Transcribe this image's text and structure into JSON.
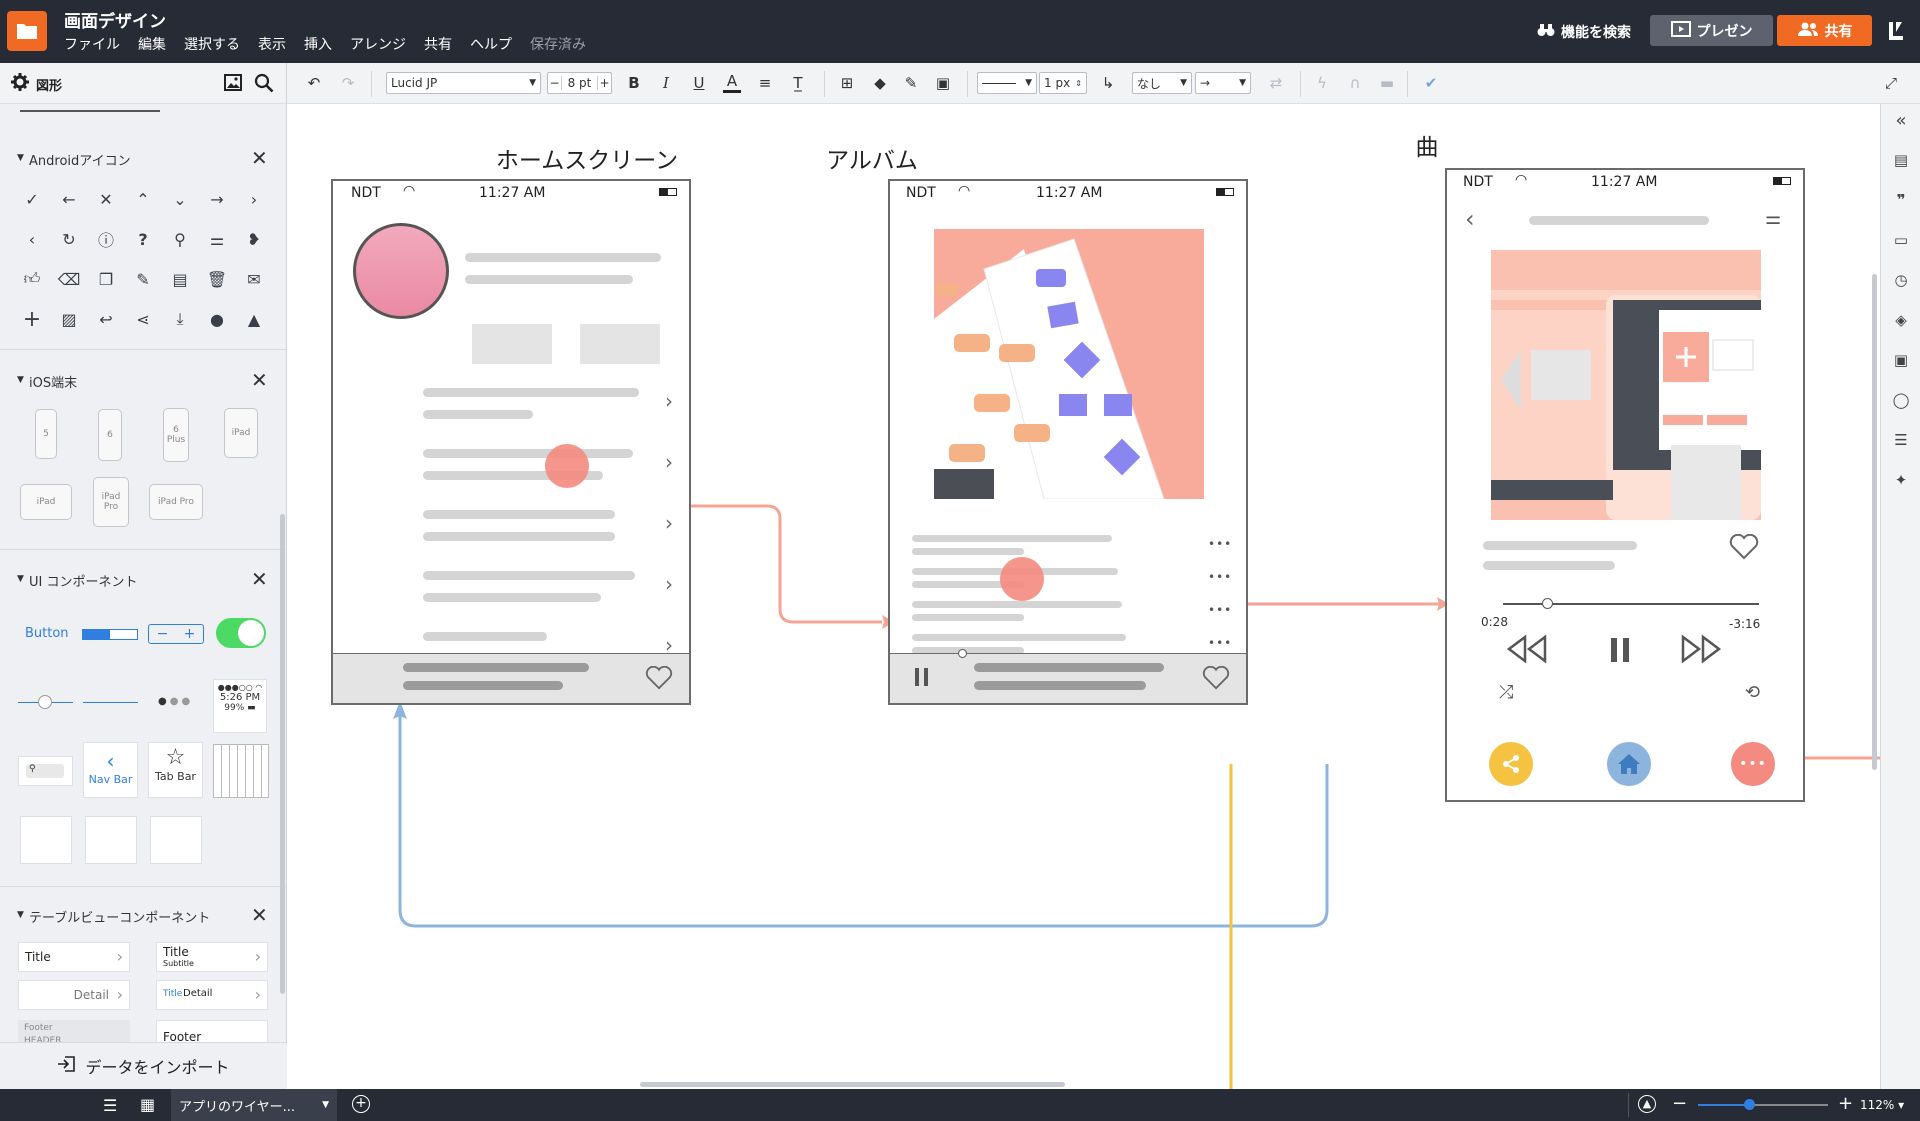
{
  "app": {
    "title": "画面デザイン",
    "menu": [
      "ファイル",
      "編集",
      "選択する",
      "表示",
      "挿入",
      "アレンジ",
      "共有",
      "ヘルプ"
    ],
    "save_status": "保存済み",
    "feature_search": "機能を検索",
    "present_label": "プレゼン",
    "share_label": "共有",
    "accent_color": "#f06a23"
  },
  "shapes_panel": {
    "title": "図形",
    "sections": {
      "android": "Androidアイコン",
      "ios": "iOS端末",
      "ui": "UI コンポーネント",
      "tableview": "テーブルビューコンポーネント"
    },
    "ios_devices": [
      "5",
      "6",
      "6 Plus",
      "iPad",
      "iPad",
      "iPad Pro",
      "iPad Pro"
    ],
    "ui_components": {
      "button": "Button",
      "status_time": "5:26 PM",
      "status_battery": "99%",
      "navbar": "Nav Bar",
      "tabbar": "Tab Bar"
    },
    "table_cells": {
      "title": "Title",
      "title2": "Title",
      "subtitle": "Subtitle",
      "detail": "Detail",
      "title3": "Title",
      "detail2": "Detail",
      "footer_small": "Footer",
      "header_small": "HEADER",
      "footer": "Footer"
    },
    "import_label": "データをインポート"
  },
  "toolbar": {
    "font": "Lucid JP",
    "font_size": "8 pt",
    "line_width": "1 px",
    "arrow_none": "なし"
  },
  "canvas": {
    "frames": [
      {
        "title": "ホームスクリーン",
        "carrier": "NDT",
        "time": "11:27 AM"
      },
      {
        "title": "アルバム",
        "carrier": "NDT",
        "time": "11:27 AM"
      },
      {
        "title": "曲",
        "carrier": "NDT",
        "time": "11:27 AM"
      }
    ],
    "song": {
      "elapsed": "0:28",
      "remaining": "-3:16",
      "progress_fraction": 0.17
    },
    "colors": {
      "flow_red": "#f5a595",
      "flow_blue": "#8db4dd",
      "share_yellow": "#f5c242",
      "home_blue": "#8db4dd",
      "more_red": "#f58a80",
      "avatar_pink": "#ee9ab0"
    }
  },
  "bottom": {
    "page_name": "アプリのワイヤー...",
    "zoom": "112%"
  },
  "icons": [
    "folder-icon",
    "binoculars-icon",
    "present-icon",
    "users-icon",
    "gear-icon",
    "image-icon",
    "search-icon",
    "undo-icon",
    "redo-icon",
    "heart-icon",
    "share-icon",
    "home-icon",
    "more-icon"
  ]
}
